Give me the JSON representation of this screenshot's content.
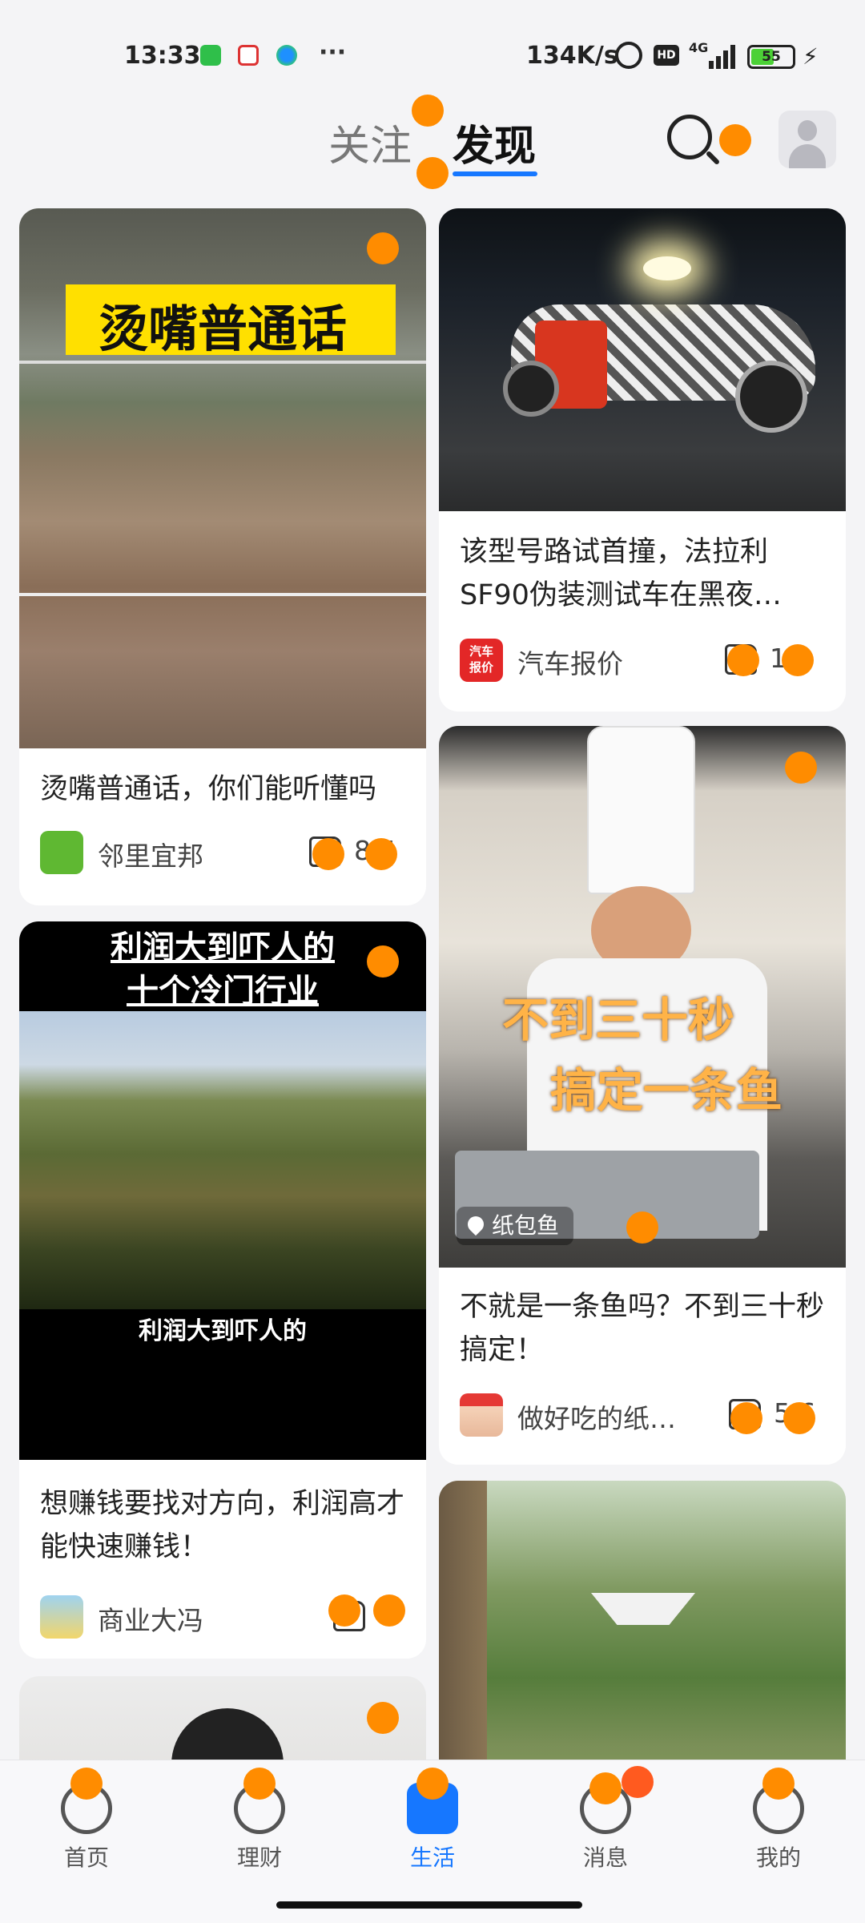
{
  "status_bar": {
    "time": "13:33",
    "more": "···",
    "network_speed": "134K/s",
    "hd": "HD",
    "signal": "4G",
    "battery": "55"
  },
  "header": {
    "tabs": [
      {
        "label": "关注",
        "active": false
      },
      {
        "label": "发现",
        "active": true
      }
    ],
    "icons": [
      "search-icon",
      "avatar-icon"
    ]
  },
  "feed": {
    "left": [
      {
        "title": "烫嘴普通话，你们能听懂吗",
        "overlay": "烫嘴普通话",
        "author": "邻里宜邦",
        "likes": "8 5"
      },
      {
        "title": "想赚钱要找对方向，利润高才能快速赚钱！",
        "overlay_top": [
          "利润大到吓人的",
          "十个冷门行业"
        ],
        "overlay_bottom": "利润大到吓人的",
        "author": "商业大冯",
        "likes": ""
      }
    ],
    "right": [
      {
        "title": "该型号路试首撞，法拉利SF90伪装测试车在黑夜…",
        "author": "汽车报价",
        "author_badge": [
          "汽车",
          "报价"
        ],
        "likes": "1 1"
      },
      {
        "title": "不就是一条鱼吗？不到三十秒搞定！",
        "overlay": [
          "不到三十秒",
          "搞定一条鱼"
        ],
        "location": "纸包鱼",
        "author": "做好吃的纸…",
        "likes": "5 6"
      }
    ]
  },
  "bottom_nav": [
    {
      "label": "首页",
      "icon": "home-icon",
      "active": false
    },
    {
      "label": "理财",
      "icon": "finance-icon",
      "active": false
    },
    {
      "label": "生活",
      "icon": "life-icon",
      "active": true
    },
    {
      "label": "消息",
      "icon": "message-icon",
      "active": false
    },
    {
      "label": "我的",
      "icon": "profile-icon",
      "active": false
    }
  ],
  "colors": {
    "accent": "#1677ff",
    "marker": "#ff8c00",
    "background": "#f4f4f6",
    "card": "#ffffff"
  }
}
